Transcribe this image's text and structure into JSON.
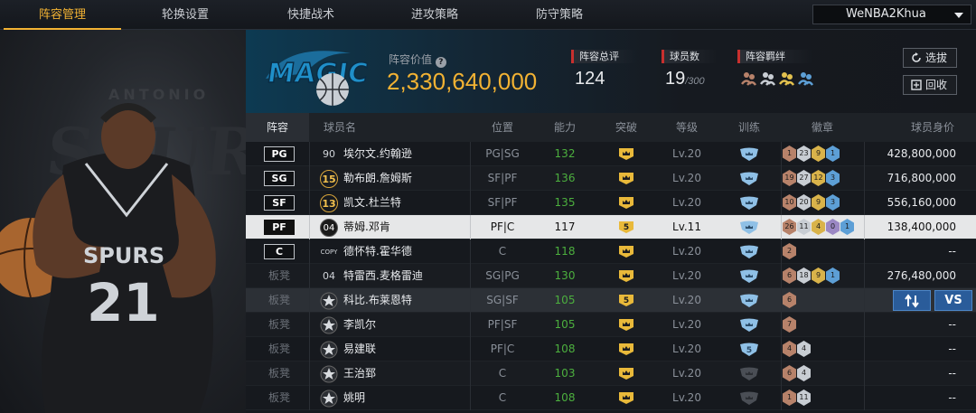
{
  "nav": {
    "tabs": [
      "阵容管理",
      "轮换设置",
      "快捷战术",
      "进攻策略",
      "防守策略"
    ],
    "active": 0,
    "user": "WeNBA2Khua"
  },
  "left_panel": {
    "team_backdrop": "SPURS",
    "team_backdrop_sub": "ANTONIO",
    "jersey_text": "SPURS",
    "jersey_number": "21"
  },
  "header": {
    "logo_text": "MAGIC",
    "value_label": "阵容价值",
    "value": "2,330,640,000",
    "total_label": "阵容总评",
    "total": "124",
    "count_label": "球员数",
    "count": "19",
    "count_max": "/300",
    "bond_label": "阵容羁绊",
    "buttons": {
      "select": "选拔",
      "recycle": "回收"
    }
  },
  "columns": [
    "阵容",
    "球员名",
    "位置",
    "能力",
    "突破",
    "等级",
    "训练",
    "徽章",
    "球员身价"
  ],
  "players": [
    {
      "slot": "PG",
      "num": "90",
      "numStyle": "plain",
      "name": "埃尔文.约翰逊",
      "pos": "PG|SG",
      "ovr": "132",
      "brk": "crown",
      "lvl": "Lv.20",
      "train": "crown",
      "badges": [
        [
          "bronze",
          "1"
        ],
        [
          "silver",
          "23"
        ],
        [
          "gold",
          "9"
        ],
        [
          "blue",
          "1"
        ]
      ],
      "value": "428,800,000"
    },
    {
      "slot": "SG",
      "num": "15",
      "numStyle": "gold",
      "name": "勒布朗.詹姆斯",
      "pos": "SF|PF",
      "ovr": "136",
      "brk": "crown",
      "lvl": "Lv.20",
      "train": "crown",
      "badges": [
        [
          "bronze",
          "19"
        ],
        [
          "silver",
          "27"
        ],
        [
          "gold",
          "12"
        ],
        [
          "blue",
          "3"
        ]
      ],
      "value": "716,800,000"
    },
    {
      "slot": "SF",
      "num": "13",
      "numStyle": "gold",
      "name": "凯文.杜兰特",
      "pos": "SF|PF",
      "ovr": "135",
      "brk": "crown",
      "lvl": "Lv.20",
      "train": "crown",
      "badges": [
        [
          "bronze",
          "10"
        ],
        [
          "silver",
          "20"
        ],
        [
          "gold",
          "9"
        ],
        [
          "blue",
          "3"
        ]
      ],
      "value": "556,160,000"
    },
    {
      "slot": "PF",
      "num": "04",
      "numStyle": "dark",
      "name": "蒂姆.邓肯",
      "pos": "PF|C",
      "ovr": "117",
      "brk": "5",
      "lvl": "Lv.11",
      "train": "crown",
      "badges": [
        [
          "bronze",
          "26"
        ],
        [
          "silver",
          "11"
        ],
        [
          "gold",
          "4"
        ],
        [
          "purple",
          "0"
        ],
        [
          "blue",
          "1"
        ]
      ],
      "value": "138,400,000",
      "selected": true
    },
    {
      "slot": "C",
      "num": "COPY",
      "numStyle": "plain",
      "name": "德怀特.霍华德",
      "pos": "C",
      "ovr": "118",
      "brk": "crown",
      "lvl": "Lv.20",
      "train": "crown",
      "badges": [
        [
          "bronze",
          "2"
        ]
      ],
      "value": "--"
    },
    {
      "slot": "板凳",
      "num": "04",
      "numStyle": "plain",
      "name": "特雷西.麦格雷迪",
      "pos": "SG|PG",
      "ovr": "130",
      "brk": "crown",
      "lvl": "Lv.20",
      "train": "crown",
      "badges": [
        [
          "bronze",
          "6"
        ],
        [
          "silver",
          "18"
        ],
        [
          "gold",
          "9"
        ],
        [
          "blue",
          "1"
        ]
      ],
      "value": "276,480,000"
    },
    {
      "slot": "板凳",
      "num": "star",
      "numStyle": "star",
      "name": "科比.布莱恩特",
      "pos": "SG|SF",
      "ovr": "105",
      "brk": "5",
      "lvl": "Lv.20",
      "train": "crown",
      "badges": [
        [
          "bronze",
          "6"
        ]
      ],
      "value": "",
      "actions": true
    },
    {
      "slot": "板凳",
      "num": "star",
      "numStyle": "star",
      "name": "李凯尔",
      "pos": "PF|SF",
      "ovr": "105",
      "brk": "crown",
      "lvl": "Lv.20",
      "train": "crown",
      "badges": [
        [
          "bronze",
          "7"
        ]
      ],
      "value": "--"
    },
    {
      "slot": "板凳",
      "num": "star",
      "numStyle": "star",
      "name": "易建联",
      "pos": "PF|C",
      "ovr": "108",
      "brk": "crown",
      "lvl": "Lv.20",
      "train": "5",
      "badges": [
        [
          "bronze",
          "4"
        ],
        [
          "silver",
          "4"
        ]
      ],
      "value": "--"
    },
    {
      "slot": "板凳",
      "num": "star",
      "numStyle": "star",
      "name": "王治郅",
      "pos": "C",
      "ovr": "103",
      "brk": "crown",
      "lvl": "Lv.20",
      "train": "dim",
      "badges": [
        [
          "bronze",
          "6"
        ],
        [
          "silver",
          "4"
        ]
      ],
      "value": "--"
    },
    {
      "slot": "板凳",
      "num": "star",
      "numStyle": "star",
      "name": "姚明",
      "pos": "C",
      "ovr": "108",
      "brk": "crown",
      "lvl": "Lv.20",
      "train": "dim",
      "badges": [
        [
          "bronze",
          "1"
        ],
        [
          "silver",
          "11"
        ]
      ],
      "value": "--"
    }
  ],
  "action_buttons": {
    "vs": "VS"
  },
  "colors": {
    "accent": "#f2b233",
    "ovr_green": "#4caf3e",
    "brand_red": "#c8302e",
    "button_blue": "#2a5c9a"
  }
}
